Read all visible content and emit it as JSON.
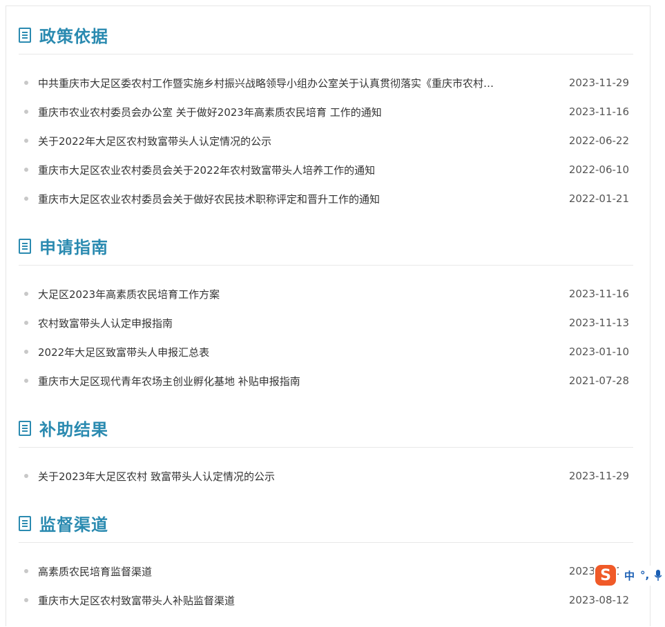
{
  "sections": [
    {
      "title": "政策依据",
      "items": [
        {
          "title": "中共重庆市大足区委农村工作暨实施乡村振兴战略领导小组办公室关于认真贯彻落实《重庆市农村…",
          "date": "2023-11-29"
        },
        {
          "title": "重庆市农业农村委员会办公室 关于做好2023年高素质农民培育 工作的通知",
          "date": "2023-11-16"
        },
        {
          "title": "关于2022年大足区农村致富带头人认定情况的公示",
          "date": "2022-06-22"
        },
        {
          "title": "重庆市大足区农业农村委员会关于2022年农村致富带头人培养工作的通知",
          "date": "2022-06-10"
        },
        {
          "title": "重庆市大足区农业农村委员会关于做好农民技术职称评定和晋升工作的通知",
          "date": "2022-01-21"
        }
      ]
    },
    {
      "title": "申请指南",
      "items": [
        {
          "title": "大足区2023年高素质农民培育工作方案",
          "date": "2023-11-16"
        },
        {
          "title": "农村致富带头人认定申报指南",
          "date": "2023-11-13"
        },
        {
          "title": "2022年大足区致富带头人申报汇总表",
          "date": "2023-01-10"
        },
        {
          "title": "重庆市大足区现代青年农场主创业孵化基地 补贴申报指南",
          "date": "2021-07-28"
        }
      ]
    },
    {
      "title": "补助结果",
      "items": [
        {
          "title": "关于2023年大足区农村 致富带头人认定情况的公示",
          "date": "2023-11-29"
        }
      ]
    },
    {
      "title": "监督渠道",
      "items": [
        {
          "title": "高素质农民培育监督渠道",
          "date": "2023-11-16"
        },
        {
          "title": "重庆市大足区农村致富带头人补贴监督渠道",
          "date": "2023-08-12"
        }
      ]
    }
  ],
  "ime": {
    "logo": "S",
    "mode": "中",
    "punct": "°,",
    "mic": "mic-icon"
  },
  "colors": {
    "accent": "#2a8ab0",
    "bullet": "#c8c8c8",
    "ime": "#f05a28"
  }
}
